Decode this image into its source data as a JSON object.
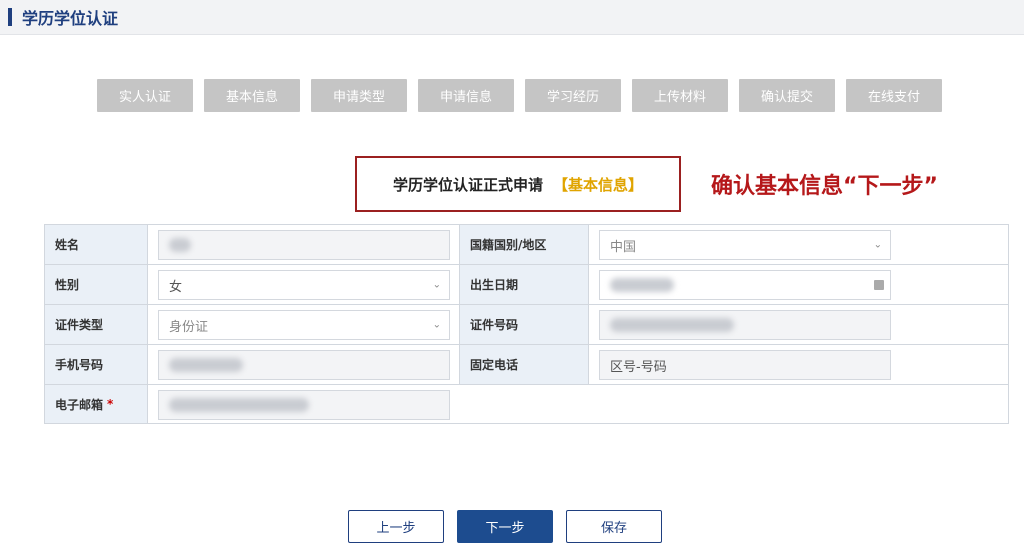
{
  "header": {
    "title": "学历学位认证"
  },
  "steps": [
    "实人认证",
    "基本信息",
    "申请类型",
    "申请信息",
    "学习经历",
    "上传材料",
    "确认提交",
    "在线支付"
  ],
  "form_title": {
    "main": "学历学位认证正式申请",
    "highlight": "【基本信息】"
  },
  "annotation": "确认基本信息“下一步”",
  "fields": {
    "name": {
      "label": "姓名"
    },
    "nationality": {
      "label": "国籍国别/地区",
      "value": "中国"
    },
    "gender": {
      "label": "性别",
      "value": "女"
    },
    "birthdate": {
      "label": "出生日期"
    },
    "id_type": {
      "label": "证件类型",
      "value": "身份证"
    },
    "id_number": {
      "label": "证件号码"
    },
    "mobile": {
      "label": "手机号码"
    },
    "landline": {
      "label": "固定电话",
      "placeholder": "区号-号码"
    },
    "email": {
      "label": "电子邮箱",
      "required_mark": "*"
    }
  },
  "buttons": {
    "prev": "上一步",
    "next": "下一步",
    "save": "保存"
  },
  "colors": {
    "accent": "#1d4c8f",
    "annotation": "#b5181a",
    "highlight": "#e0a400",
    "step_bg": "#c5c5c5"
  }
}
